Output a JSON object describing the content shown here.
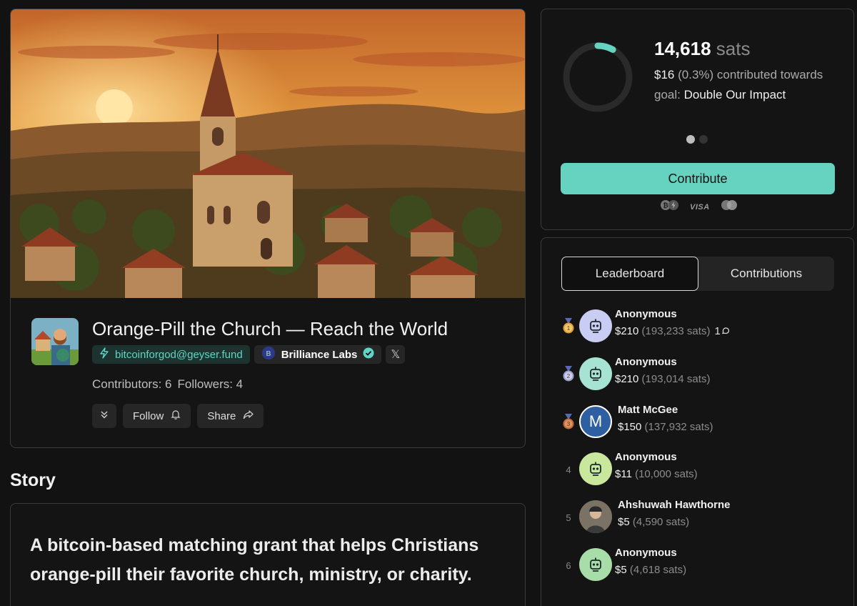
{
  "project": {
    "title": "Orange-Pill the Church — Reach the World",
    "lightning_address": "bitcoinforgod@geyser.fund",
    "org_name": "Brilliance Labs",
    "x_label": "𝕏",
    "contributors": "Contributors: 6",
    "followers": "Followers: 4",
    "follow_label": "Follow",
    "share_label": "Share"
  },
  "story": {
    "heading": "Story",
    "text": "A bitcoin-based matching grant that helps Christians orange-pill their favorite church, ministry, or charity."
  },
  "funding": {
    "sats_amount": "14,618",
    "sats_unit": "sats",
    "usd": "$16",
    "pct": "(0.3%)",
    "contributed_text": "contributed towards goal:",
    "goal_name": "Double Our Impact",
    "progress_fraction": 0.003,
    "contribute_label": "Contribute",
    "visa_label": "VISA",
    "accent_color": "#66d3c1"
  },
  "tabs": [
    {
      "label": "Leaderboard",
      "active": true
    },
    {
      "label": "Contributions",
      "active": false
    }
  ],
  "leaderboard": [
    {
      "rank": "1",
      "medal": "gold",
      "name": "Anonymous",
      "usd": "$210",
      "sats": "(193,233 sats)",
      "extra": "1",
      "avatar": "robot-1",
      "avatar_bg": "#c9cdf4"
    },
    {
      "rank": "2",
      "medal": "silver",
      "name": "Anonymous",
      "usd": "$210",
      "sats": "(193,014 sats)",
      "extra": "",
      "avatar": "robot-2",
      "avatar_bg": "#a6e3d2"
    },
    {
      "rank": "3",
      "medal": "bronze",
      "name": "Matt McGee",
      "usd": "$150",
      "sats": "(137,932 sats)",
      "extra": "",
      "avatar": "M",
      "avatar_bg": "#2f5fa3"
    },
    {
      "rank": "4",
      "medal": "",
      "name": "Anonymous",
      "usd": "$11",
      "sats": "(10,000 sats)",
      "extra": "",
      "avatar": "robot-4",
      "avatar_bg": "#c9e89e"
    },
    {
      "rank": "5",
      "medal": "",
      "name": "Ahshuwah Hawthorne",
      "usd": "$5",
      "sats": "(4,590 sats)",
      "extra": "",
      "avatar": "photo",
      "avatar_bg": "#6b6355"
    },
    {
      "rank": "6",
      "medal": "",
      "name": "Anonymous",
      "usd": "$5",
      "sats": "(4,618 sats)",
      "extra": "",
      "avatar": "robot-6",
      "avatar_bg": "#a8dca8"
    }
  ]
}
